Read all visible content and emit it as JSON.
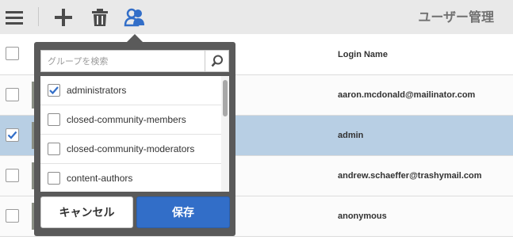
{
  "header": {
    "title": "ユーザー管理",
    "icons": [
      "hamburger-icon",
      "add-icon",
      "trash-icon",
      "group-icon"
    ],
    "accent_color": "#326ec8"
  },
  "table": {
    "column_login": "Login Name",
    "rows": [
      {
        "login": "aaron.mcdonald@mailinator.com",
        "selected": false
      },
      {
        "login": "admin",
        "selected": true
      },
      {
        "login": "andrew.schaeffer@trashymail.com",
        "selected": false
      },
      {
        "login": "anonymous",
        "selected": false
      }
    ]
  },
  "group_popover": {
    "search_placeholder": "グループを検索",
    "groups": [
      {
        "label": "administrators",
        "checked": true
      },
      {
        "label": "closed-community-members",
        "checked": false
      },
      {
        "label": "closed-community-moderators",
        "checked": false
      },
      {
        "label": "content-authors",
        "checked": false
      }
    ],
    "cancel_label": "キャンセル",
    "save_label": "保存"
  }
}
